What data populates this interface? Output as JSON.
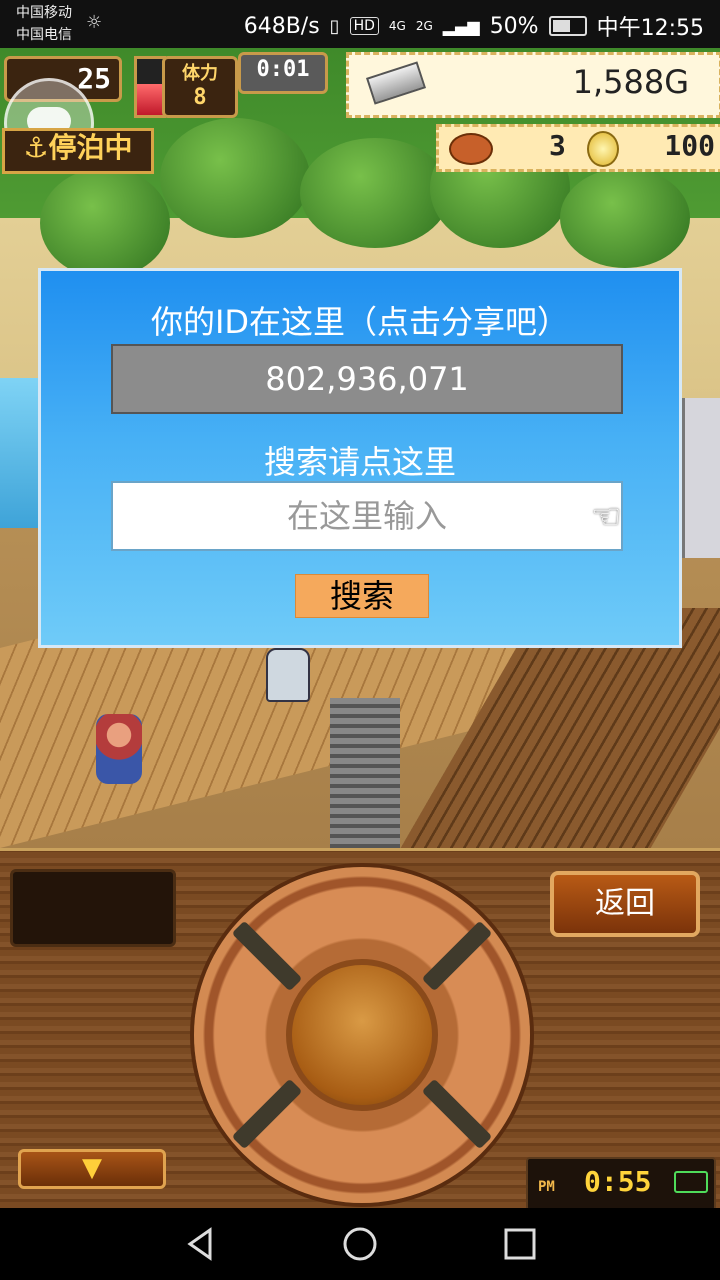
{
  "status_bar": {
    "carrier1": "中国移动",
    "carrier2": "中国电信",
    "net_speed": "648B/s",
    "hd_icon": "HD",
    "network1": "4G",
    "network2": "2G",
    "battery_percent": "50%",
    "time": "中午12:55"
  },
  "hud": {
    "level": "25",
    "stamina_label": "体力",
    "stamina_value": "8",
    "timer": "0:01",
    "gold": "1,588G",
    "status_tag": "停泊中",
    "item_count": "3",
    "medal_count": "100"
  },
  "dialog": {
    "id_title": "你的ID在这里（点击分享吧）",
    "id_value": "802,936,071",
    "search_title": "搜索请点这里",
    "search_placeholder": "在这里输入",
    "search_button": "搜索"
  },
  "controls": {
    "back_button": "返回",
    "clock_prefix": "PM",
    "clock_time": "0:55"
  },
  "colors": {
    "dialog_top": "#1f8ff0",
    "dialog_bottom": "#6fcbf8",
    "search_button_bg": "#f5a95c",
    "id_box_bg": "#8c8c8c",
    "wood": "#7a4a22"
  }
}
